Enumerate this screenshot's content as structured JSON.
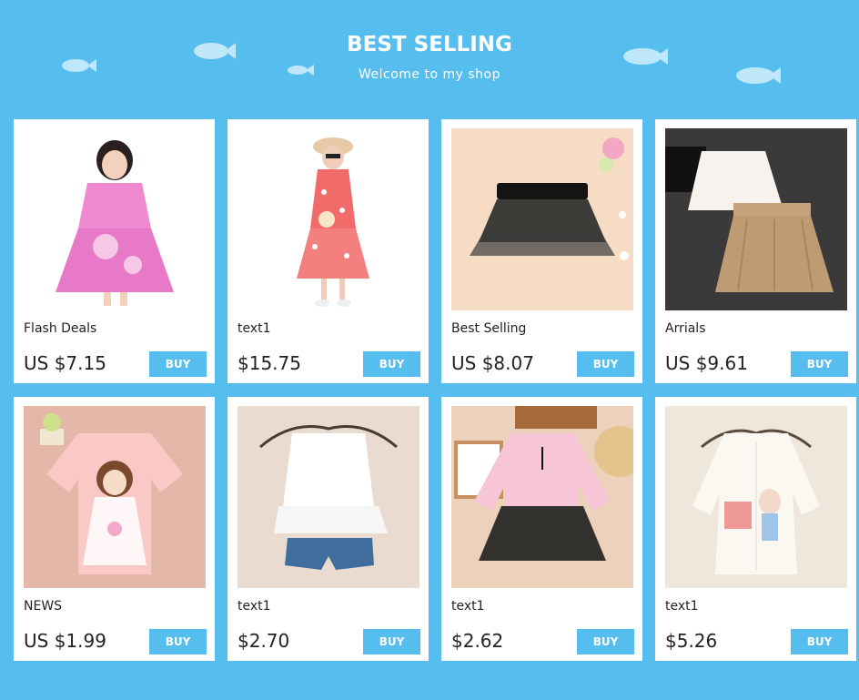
{
  "header": {
    "title": "BEST SELLING",
    "subtitle": "Welcome to my shop"
  },
  "colors": {
    "background": "#56bdef",
    "card": "#ffffff",
    "button": "#56bdef",
    "fish": "#bfe7fa"
  },
  "products": [
    {
      "name": "Flash Deals",
      "price": "US $7.15",
      "buy_label": "BUY",
      "image": "girl-pink-qipao-dress"
    },
    {
      "name": "text1",
      "price": "$15.75",
      "buy_label": "BUY",
      "image": "girl-floral-dress-hat"
    },
    {
      "name": "Best Selling",
      "price": "US $8.07",
      "buy_label": "BUY",
      "image": "black-tutu-skirt"
    },
    {
      "name": "Arrials",
      "price": "US $9.61",
      "buy_label": "BUY",
      "image": "white-and-khaki-skirts"
    },
    {
      "name": "NEWS",
      "price": "US $1.99",
      "buy_label": "BUY",
      "image": "pink-cartoon-girl-tee"
    },
    {
      "name": "text1",
      "price": "$2.70",
      "buy_label": "BUY",
      "image": "white-ruffle-top-denim-shorts"
    },
    {
      "name": "text1",
      "price": "$2.62",
      "buy_label": "BUY",
      "image": "pink-blouse-black-skirt"
    },
    {
      "name": "text1",
      "price": "$5.26",
      "buy_label": "BUY",
      "image": "white-bunny-shirt"
    }
  ]
}
